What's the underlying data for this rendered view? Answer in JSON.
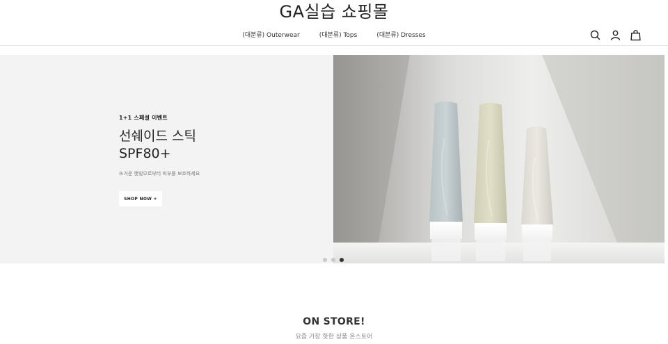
{
  "header": {
    "title": "GA실습 쇼핑몰",
    "nav": [
      {
        "label": "(대분류) Outerwear"
      },
      {
        "label": "(대분류) Tops"
      },
      {
        "label": "(대분류) Dresses"
      }
    ],
    "icons": [
      "search-icon",
      "user-icon",
      "shopping-bag-icon"
    ]
  },
  "hero": {
    "eyebrow": "1+1 스페셜 이벤트",
    "headline_line1": "선쉐이드 스틱",
    "headline_line2": "SPF80+",
    "subcopy": "뜨거운 햇빛으로부터 피부를 보호하세요",
    "cta_label": "SHOP NOW +",
    "background_color": "#f3f3f3",
    "slides": {
      "count": 3,
      "active_index": 2
    }
  },
  "section": {
    "title": "ON STORE!",
    "subtitle": "요즘 가장 핫한 상품 온스토어"
  }
}
